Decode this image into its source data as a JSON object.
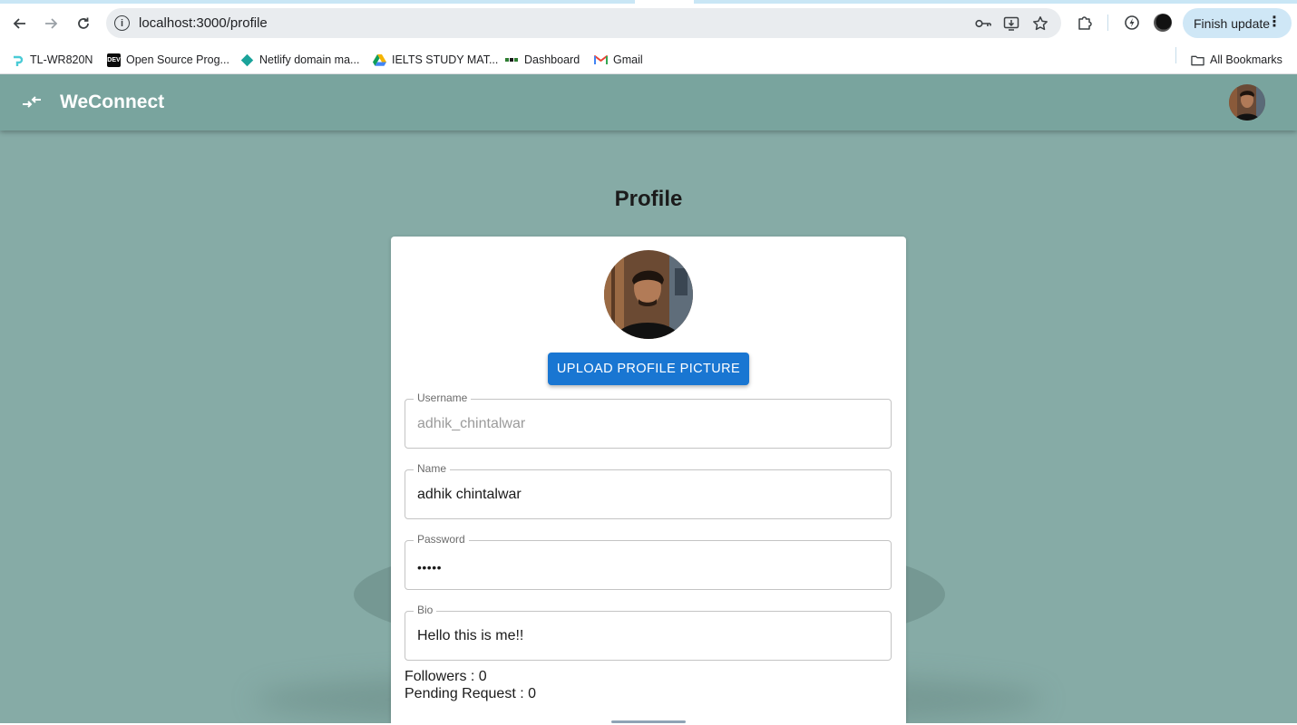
{
  "browser": {
    "url": "localhost:3000/profile",
    "finish_update_label": "Finish update",
    "bookmarks": [
      {
        "label": "TL-WR820N",
        "icon": "tplink-icon"
      },
      {
        "label": "Open Source Prog...",
        "icon": "dev-icon",
        "icon_text": "DEV"
      },
      {
        "label": "Netlify domain ma...",
        "icon": "netlify-icon"
      },
      {
        "label": "IELTS STUDY MAT...",
        "icon": "google-drive-icon"
      },
      {
        "label": "Dashboard",
        "icon": "dashboard-icon"
      },
      {
        "label": "Gmail",
        "icon": "gmail-icon",
        "icon_text": "M"
      }
    ],
    "all_bookmarks_label": "All Bookmarks"
  },
  "app": {
    "brand": "WeConnect"
  },
  "profile": {
    "title": "Profile",
    "upload_label": "UPLOAD PROFILE PICTURE",
    "fields": {
      "username": {
        "label": "Username",
        "value": "adhik_chintalwar"
      },
      "name": {
        "label": "Name",
        "value": "adhik chintalwar"
      },
      "password": {
        "label": "Password",
        "value": "•••••"
      },
      "bio": {
        "label": "Bio",
        "value": "Hello this is me!!"
      }
    },
    "followers": "Followers : 0",
    "pending": "Pending Request : 0"
  },
  "colors": {
    "app_bar": "#79a49e",
    "background": "#86aba6",
    "primary_button": "#1976d2"
  }
}
